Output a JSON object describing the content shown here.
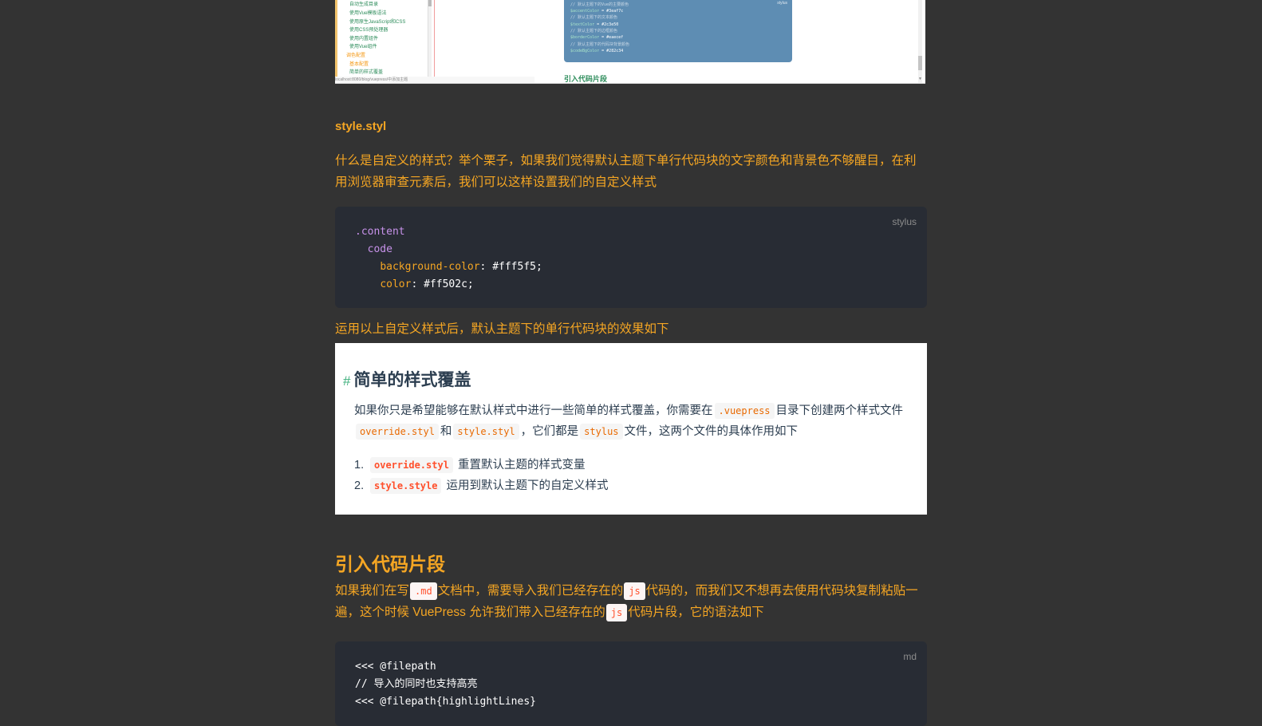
{
  "top_screenshot": {
    "sidebar_items": [
      "自动生成目录",
      "使用Vue模板语法",
      "使用原生JavaScript和CSS",
      "使用CSS预处理器",
      "使用内置组件",
      "使用Vue组件"
    ],
    "sidebar_orange_items": [
      "调色配置",
      "基本配置"
    ],
    "sidebar_last_item": "简单的样式覆盖",
    "status_url": "localhost:8080/blog/vuepress/中添加主题",
    "code_lines": [
      {
        "comment": "// 默认主题下的Vue的主要颜色"
      },
      {
        "key": "$accentColor",
        "val": "#3eaf7c"
      },
      {
        "comment": "// 默认主题下的文本颜色"
      },
      {
        "key": "$textColor",
        "val": "#2c3e50"
      },
      {
        "comment": "// 默认主题下的边框颜色"
      },
      {
        "key": "$borderColor",
        "val": "#eaecef"
      },
      {
        "comment": "// 默认主题下的代码块背景颜色"
      },
      {
        "key": "$codeBgColor",
        "val": "#282c34"
      }
    ],
    "code_tag": "stylus",
    "snippet_title": "引入代码片段"
  },
  "article": {
    "file_heading": "style.styl",
    "para1": "什么是自定义的样式？举个栗子，如果我们觉得默认主题下单行代码块的文字颜色和背景色不够醒目，在利用浏览器审查元素后，我们可以这样设置我们的自定义样式",
    "code1": {
      "lang": "stylus",
      "selector1": ".content",
      "selector2": "code",
      "prop1": "background-color",
      "val1": "#fff5f5;",
      "prop2": "color",
      "val2": "#ff502c;"
    },
    "para2": "运用以上自定义样式后，默认主题下的单行代码块的效果如下",
    "shot": {
      "hash": "#",
      "heading": "简单的样式覆盖",
      "line1_a": "如果你只是希望能够在默认样式中进行一些简单的样式覆盖，你需要在",
      "code_vuepress": ".vuepress",
      "line1_b": "目录下创建两个样式文件",
      "code_override": "override.styl",
      "and": "和",
      "code_style": "style.styl",
      "line2_a": "，它们都是",
      "code_stylus": "stylus",
      "line2_b": "文件，这两个文件的具体作用如下",
      "list": [
        {
          "num": "1.",
          "code": "override.styl",
          "text": "重置默认主题的样式变量"
        },
        {
          "num": "2.",
          "code": "style.style",
          "text": "运用到默认主题下的自定义样式"
        }
      ]
    },
    "section_heading": "引入代码片段",
    "para3": {
      "a": "如果我们在写",
      "code_md": ".md",
      "b": "文档中，需要导入我们已经存在的",
      "code_js1": "js",
      "c": "代码的，而我们又不想再去使用代码块复制粘贴一遍，这个时候 VuePress 允许我们带入已经存在的",
      "code_js2": "js",
      "d": "代码片段，它的语法如下"
    },
    "code2": {
      "lang": "md",
      "line1": "<<< @filepath",
      "line2": "// 导入的同时也支持高亮",
      "line3": "<<< @filepath{highlightLines}"
    }
  }
}
